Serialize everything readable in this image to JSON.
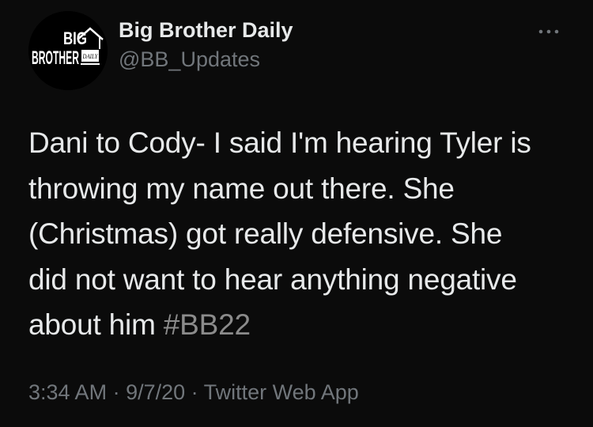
{
  "author": {
    "display_name": "Big Brother Daily",
    "handle": "@BB_Updates",
    "avatar_logo": {
      "line1": "BIG",
      "line2": "BROTHER",
      "tag": "DAILY"
    }
  },
  "more_icon": "more-horizontal-icon",
  "tweet": {
    "lines": [
      "Dani to Cody- I said I'm hearing Tyler is",
      "throwing my name out there. She",
      "(Christmas) got really defensive. She",
      "did not want to hear anything negative",
      "about him "
    ],
    "hashtag": "#BB22"
  },
  "meta": {
    "time": "3:34 AM",
    "sep1": " · ",
    "date": "9/7/20",
    "sep2": " · ",
    "source": "Twitter Web App"
  },
  "colors": {
    "background": "#0b0b0b",
    "text": "#e7e9ea",
    "secondary": "#71767b",
    "hashtag": "#8b8b8b"
  }
}
